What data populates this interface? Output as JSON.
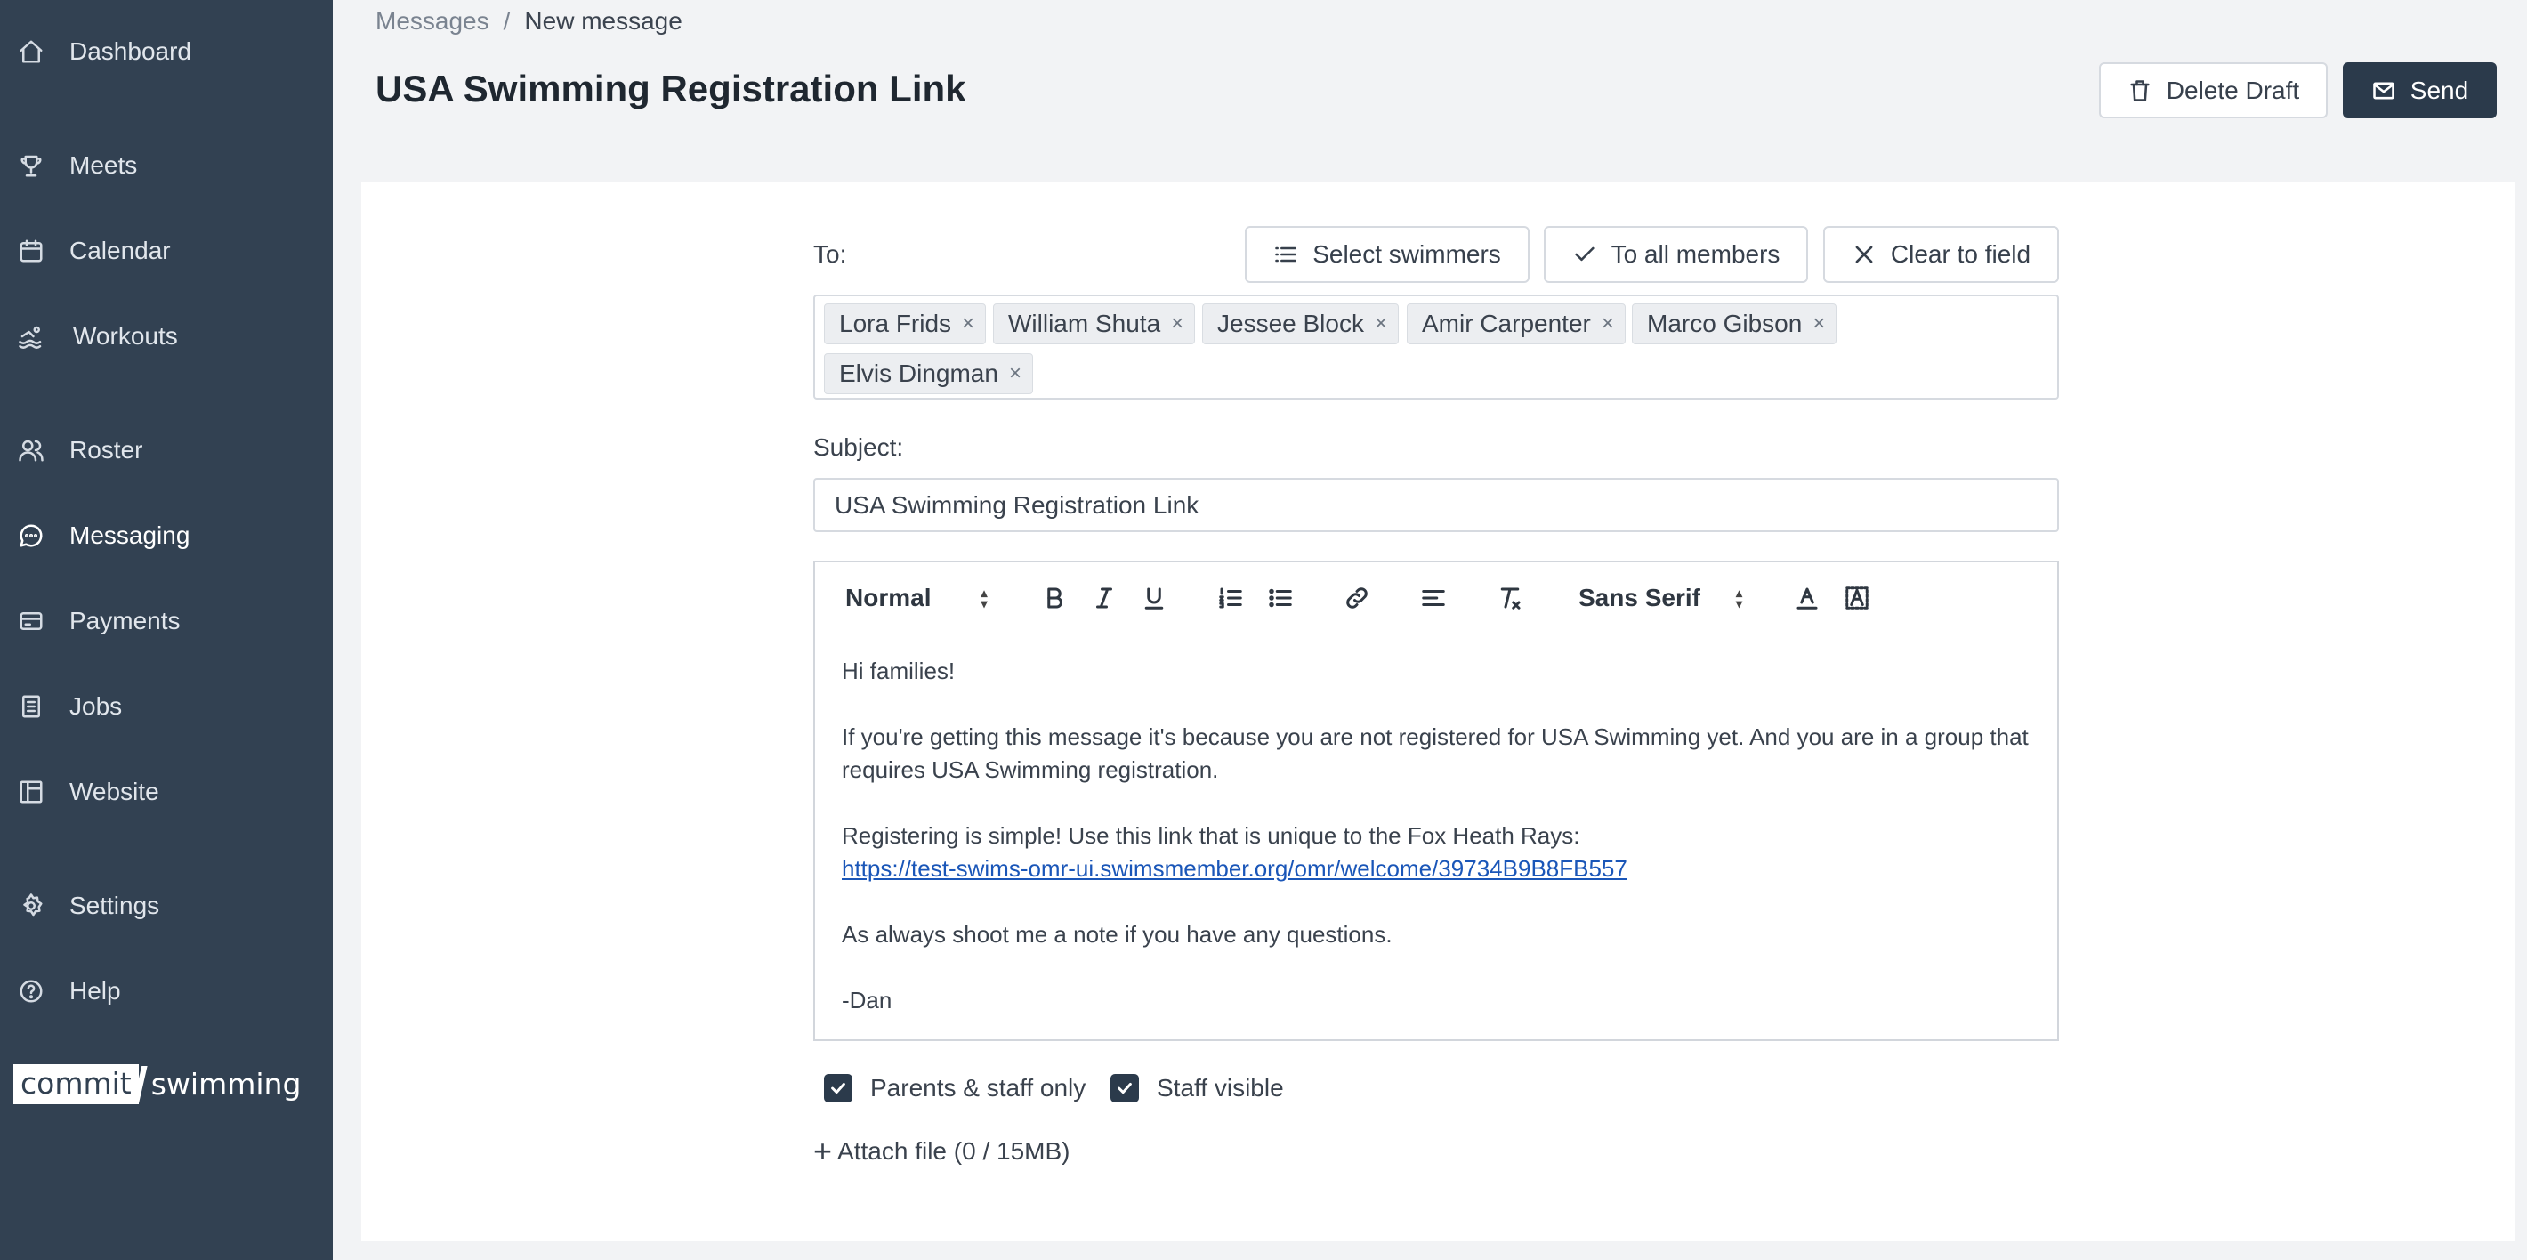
{
  "sidebar": {
    "items": [
      {
        "label": "Dashboard",
        "icon": "home-icon"
      },
      {
        "label": "Meets",
        "icon": "trophy-icon"
      },
      {
        "label": "Calendar",
        "icon": "calendar-icon"
      },
      {
        "label": "Workouts",
        "icon": "swimmer-icon"
      },
      {
        "label": "Roster",
        "icon": "people-icon"
      },
      {
        "label": "Messaging",
        "icon": "chat-icon"
      },
      {
        "label": "Payments",
        "icon": "credit-card-icon"
      },
      {
        "label": "Jobs",
        "icon": "clipboard-icon"
      },
      {
        "label": "Website",
        "icon": "layout-icon"
      },
      {
        "label": "Settings",
        "icon": "gear-icon"
      },
      {
        "label": "Help",
        "icon": "help-circle-icon"
      }
    ],
    "active": "Messaging",
    "logo": {
      "part1": "commit",
      "part2": "swimming"
    }
  },
  "breadcrumb": {
    "parent": "Messages",
    "separator": "/",
    "current": "New message"
  },
  "page": {
    "title": "USA Swimming Registration Link"
  },
  "actions": {
    "delete_draft": "Delete Draft",
    "send": "Send"
  },
  "compose": {
    "to_label": "To:",
    "select_swimmers": "Select swimmers",
    "to_all_members": "To all members",
    "clear_to_field": "Clear to field",
    "recipients": [
      "Lora Frids",
      "William Shuta",
      "Jessee Block",
      "Amir Carpenter",
      "Marco Gibson",
      "Elvis Dingman"
    ],
    "remove_symbol": "×",
    "subject_label": "Subject:",
    "subject_value": "USA Swimming Registration Link",
    "toolbar": {
      "format": "Normal",
      "font": "Sans Serif"
    },
    "body": {
      "greeting": "Hi families!",
      "para1": "If you're getting this message it's because you are not registered for USA Swimming yet. And you are in a group that requires USA Swimming registration.",
      "para2": "Registering is simple! Use this link that is unique to the Fox Heath Rays:",
      "link": "https://test-swims-omr-ui.swimsmember.org/omr/welcome/39734B9B8FB557",
      "para3": "As always shoot me a note if you have any questions.",
      "signature": "-Dan"
    },
    "options": {
      "parents_staff_only": "Parents & staff only",
      "staff_visible": "Staff visible"
    },
    "attach": "Attach file (0 / 15MB)"
  },
  "colors": {
    "sidebar_bg": "#324152",
    "primary_button": "#2b3a4b",
    "link": "#1a56b8"
  }
}
